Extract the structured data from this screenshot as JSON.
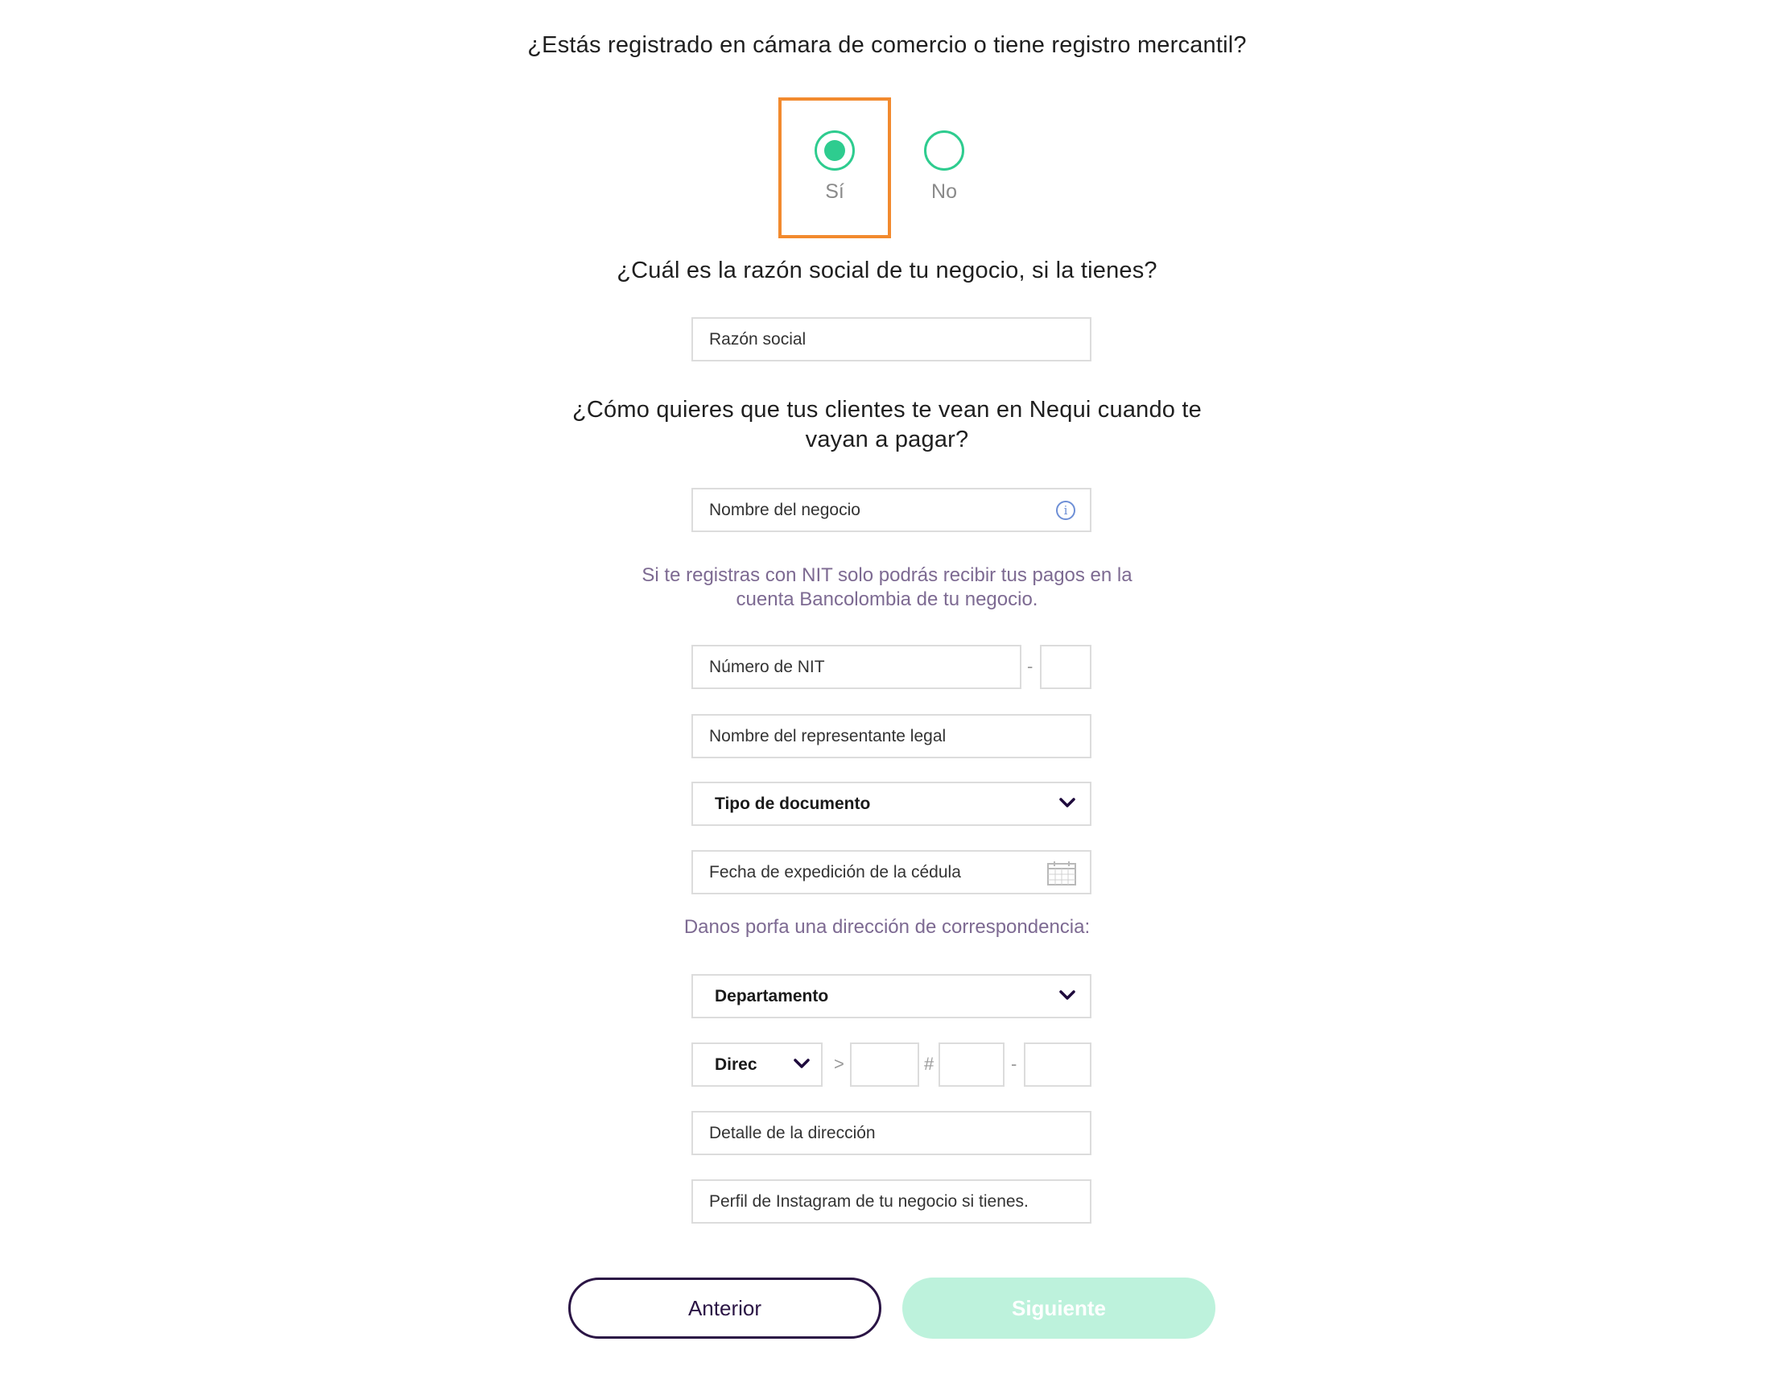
{
  "q_registered": "¿Estás registrado en cámara de comercio o tiene registro mercantil?",
  "radio_yes_label": "Sí",
  "radio_no_label": "No",
  "radio_selected": "Sí",
  "q_razon_social": "¿Cuál es la razón social de tu negocio, si la tienes?",
  "razon_social_placeholder": "Razón social",
  "q_nombre_clientes": "¿Cómo quieres que tus clientes te vean en Nequi cuando te vayan a pagar?",
  "nombre_negocio_placeholder": "Nombre del negocio",
  "nit_note": "Si te registras con NIT solo podrás recibir tus pagos en la cuenta Bancolombia de tu negocio.",
  "nit_placeholder": "Número de NIT",
  "nit_dash": "-",
  "representante_placeholder": "Nombre del representante legal",
  "tipo_documento_label": "Tipo de documento",
  "fecha_placeholder": "Fecha de expedición de la cédula",
  "direccion_note": "Danos porfa una dirección de correspondencia:",
  "departamento_label": "Departamento",
  "direc_label": "Direc",
  "addr_sep_gt": ">",
  "addr_sep_hash": "#",
  "addr_sep_dash": "-",
  "detalle_placeholder": "Detalle de la dirección",
  "instagram_placeholder": "Perfil de Instagram de tu negocio si tienes.",
  "btn_prev": "Anterior",
  "btn_next": "Siguiente",
  "colors": {
    "accent_green": "#2ecc8f",
    "highlight_orange": "#f28a2e",
    "dark_purple": "#2b1545",
    "next_disabled_bg": "#bdf2dc"
  },
  "icons": [
    "info-icon",
    "calendar-icon",
    "chevron-down-icon"
  ]
}
